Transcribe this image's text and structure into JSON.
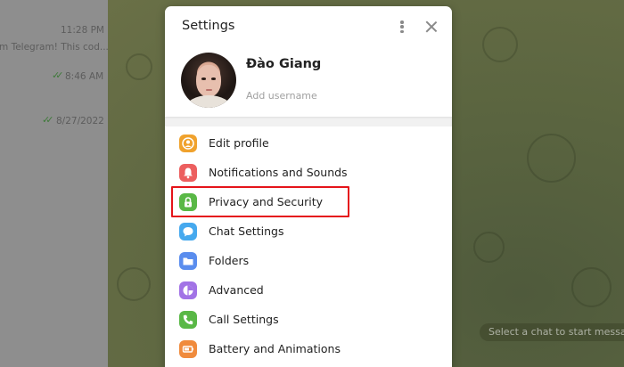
{
  "chat_list": {
    "items": [
      {
        "time": "11:28 PM",
        "preview": "m Telegram!  This cod..."
      },
      {
        "time": "8:46 AM",
        "preview": ""
      },
      {
        "time": "8/27/2022",
        "preview": ""
      }
    ]
  },
  "background": {
    "placeholder": "Select a chat to start messagin"
  },
  "settings": {
    "title": "Settings",
    "profile": {
      "name": "Đào Giang",
      "username_placeholder": "Add username"
    },
    "menu": [
      {
        "label": "Edit profile",
        "icon": "person-icon",
        "color": "#f0a22d"
      },
      {
        "label": "Notifications and Sounds",
        "icon": "bell-icon",
        "color": "#ec5f5f"
      },
      {
        "label": "Privacy and Security",
        "icon": "lock-icon",
        "color": "#59b846"
      },
      {
        "label": "Chat Settings",
        "icon": "speech-bubble-icon",
        "color": "#46a9ee"
      },
      {
        "label": "Folders",
        "icon": "folder-icon",
        "color": "#5a8dee"
      },
      {
        "label": "Advanced",
        "icon": "pie-chart-icon",
        "color": "#a273e6"
      },
      {
        "label": "Call Settings",
        "icon": "phone-icon",
        "color": "#59b846"
      },
      {
        "label": "Battery and Animations",
        "icon": "battery-icon",
        "color": "#f08b3d"
      }
    ]
  },
  "colors": {
    "highlight": "#e5141a",
    "check": "#3f7a3a"
  }
}
